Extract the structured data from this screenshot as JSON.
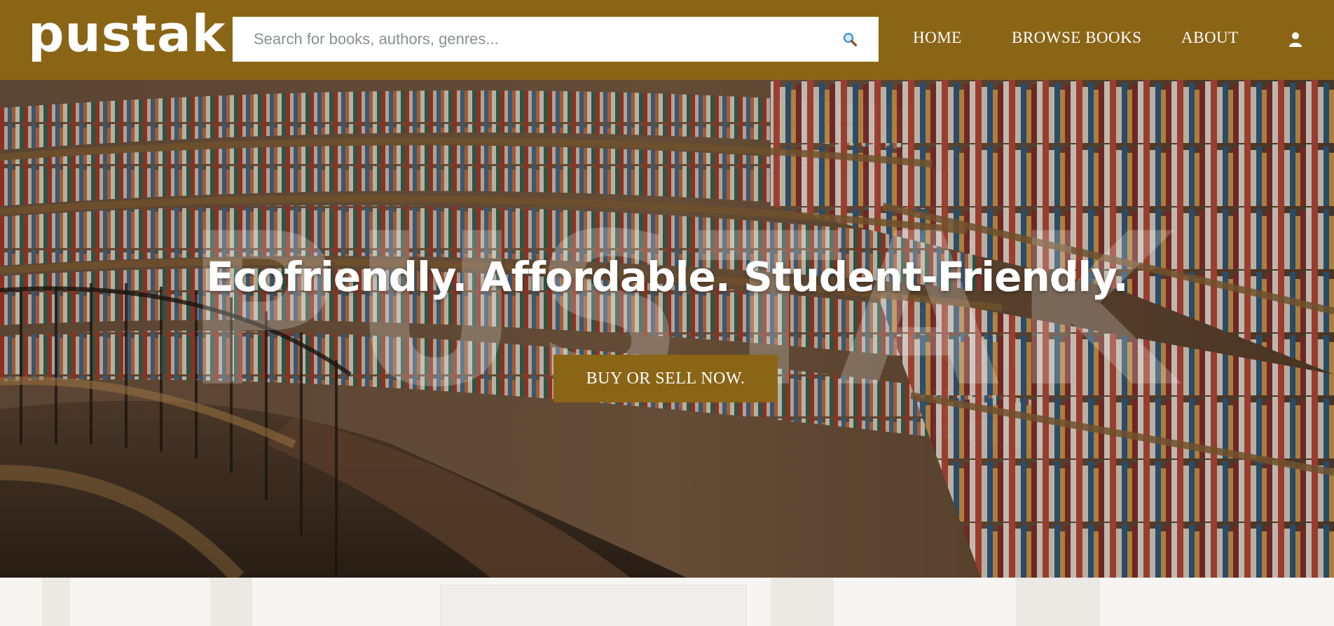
{
  "header": {
    "logo": "pustak",
    "search": {
      "placeholder": "Search for books, authors, genres...",
      "value": ""
    },
    "nav": [
      {
        "label": "HOME"
      },
      {
        "label": "BROWSE BOOKS"
      },
      {
        "label": "ABOUT"
      }
    ],
    "icons": {
      "search": "search-icon",
      "user": "user-icon"
    }
  },
  "hero": {
    "watermark": "PUSTAK",
    "tagline": "Ecofriendly. Affordable. Student-Friendly.",
    "cta_label": "BUY OR SELL NOW."
  },
  "colors": {
    "brand": "#8a6516",
    "text_on_brand": "#ffffff",
    "bottom_background": "#f7f5f2"
  }
}
